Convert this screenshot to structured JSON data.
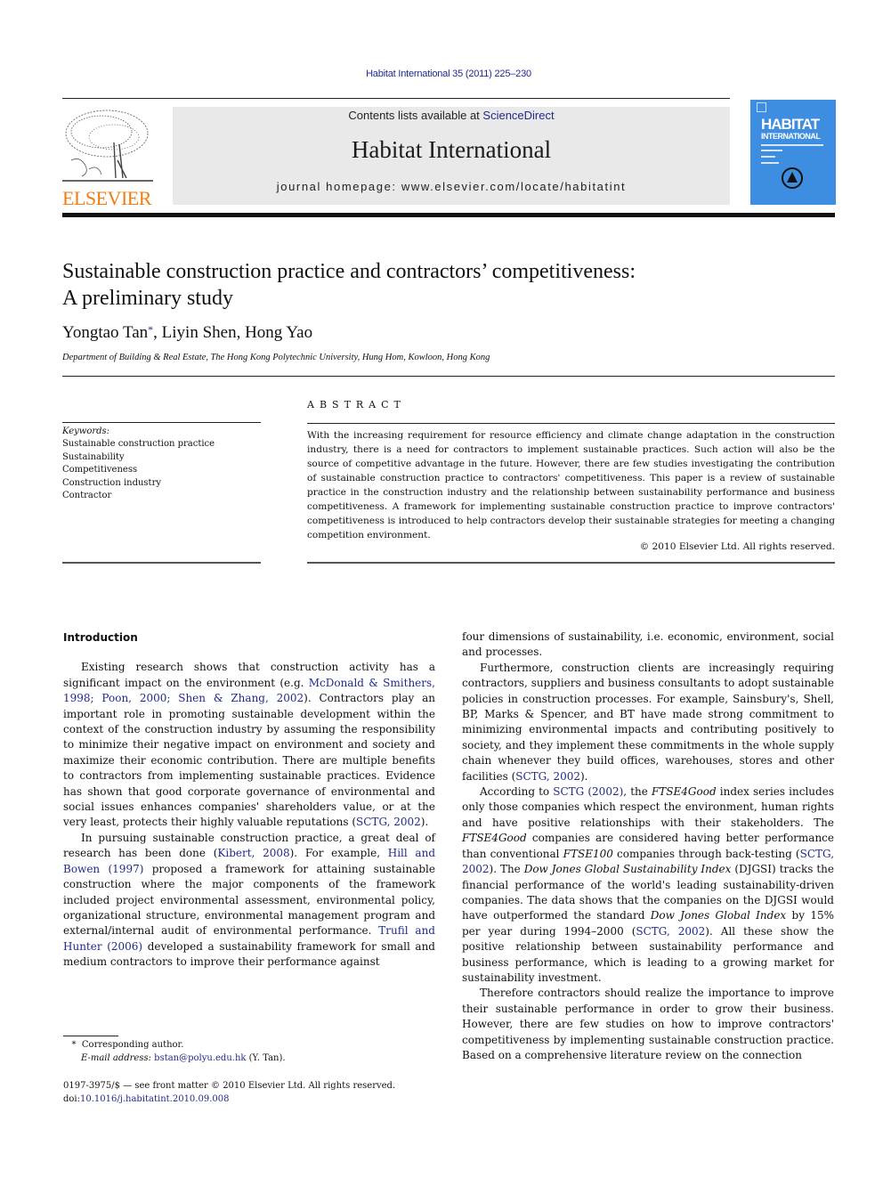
{
  "header": {
    "citation": "Habitat International 35 (2011) 225–230",
    "contents_prefix": "Contents lists available at ",
    "contents_link": "ScienceDirect",
    "journal_name": "Habitat International",
    "homepage": "journal homepage: www.elsevier.com/locate/habitatint",
    "publisher_logo_text": "ELSEVIER",
    "cover_title": "HABITAT",
    "cover_subtitle": "INTERNATIONAL"
  },
  "colors": {
    "link": "#1f2a8a",
    "elsevier_orange": "#f07c12",
    "cover_blue": "#3d8ee0",
    "masthead_gray": "#e9e9e9"
  },
  "article": {
    "title_line1": "Sustainable construction practice and contractors’ competitiveness:",
    "title_line2": "A preliminary study",
    "author1": "Yongtao Tan",
    "author1_mark": "*",
    "authors_rest": ", Liyin Shen, Hong Yao",
    "affiliation": "Department of Building & Real Estate, The Hong Kong Polytechnic University, Hung Hom, Kowloon, Hong Kong"
  },
  "keywords": {
    "label": "Keywords:",
    "items": [
      "Sustainable construction practice",
      "Sustainability",
      "Competitiveness",
      "Construction industry",
      "Contractor"
    ]
  },
  "abstract": {
    "heading": "ABSTRACT",
    "text": "With the increasing requirement for resource efficiency and climate change adaptation in the construction industry, there is a need for contractors to implement sustainable practices. Such action will also be the source of competitive advantage in the future. However, there are few studies investigating the contribution of sustainable construction practice to contractors' competitiveness. This paper is a review of sustainable practice in the construction industry and the relationship between sustainability performance and business competitiveness. A framework for implementing sustainable construction practice to improve contractors' competitiveness is introduced to help contractors develop their sustainable strategies for meeting a changing competition environment.",
    "copyright": "© 2010 Elsevier Ltd. All rights reserved."
  },
  "body": {
    "section_heading": "Introduction",
    "p1": {
      "t1": "Existing research shows that construction activity has a significant impact on the environment (e.g. ",
      "l1": "McDonald & Smithers, 1998; Poon, 2000; Shen & Zhang, 2002",
      "t2": "). Contractors play an important role in promoting sustainable development within the context of the construction industry by assuming the responsibility to minimize their negative impact on environment and society and maximize their economic contribution. There are multiple benefits to contractors from implementing sustainable practices. Evidence has shown that good corporate governance of environmental and social issues enhances companies' shareholders value, or at the very least, protects their highly valuable reputations (",
      "l2": "SCTG, 2002",
      "t3": ")."
    },
    "p2": {
      "t1": "In pursuing sustainable construction practice, a great deal of research has been done (",
      "l1": "Kibert, 2008",
      "t2": "). For example, ",
      "l2": "Hill and Bowen (1997)",
      "t3": " proposed a framework for attaining sustainable construction where the major components of the framework included project environmental assessment, environmental policy, organizational structure, environmental management program and external/internal audit of environmental performance. ",
      "l3": "Trufil and Hunter (2006)",
      "t4": " developed a sustainability framework for small and medium contractors to improve their performance against"
    },
    "p3": {
      "t1": "four dimensions of sustainability, i.e. economic, environment, social and processes."
    },
    "p4": {
      "t1": "Furthermore, construction clients are increasingly requiring contractors, suppliers and business consultants to adopt sustainable policies in construction processes. For example, Sainsbury's, Shell, BP, Marks & Spencer, and BT have made strong commitment to minimizing environmental impacts and contributing positively to society, and they implement these commitments in the whole supply chain whenever they build offices, warehouses, stores and other facilities (",
      "l1": "SCTG, 2002",
      "t2": ")."
    },
    "p5": {
      "t1": "According to ",
      "l1": "SCTG (2002)",
      "t2": ", the ",
      "i1": "FTSE4Good",
      "t3": " index series includes only those companies which respect the environment, human rights and have positive relationships with their stakeholders. The ",
      "i2": "FTSE4Good",
      "t4": " companies are considered having better performance than conventional ",
      "i3": "FTSE100",
      "t5": " companies through back-testing (",
      "l2": "SCTG, 2002",
      "t6": "). The ",
      "i4": "Dow Jones Global Sustainability Index",
      "t7": " (DJGSI) tracks the financial performance of the world's leading sustainability-driven companies. The data shows that the companies on the DJGSI would have outperformed the standard ",
      "i5": "Dow Jones Global Index",
      "t8": " by 15% per year during 1994–2000 (",
      "l3": "SCTG, 2002",
      "t9": "). All these show the positive relationship between sustainability performance and business performance, which is leading to a growing market for sustainability investment."
    },
    "p6": {
      "t1": "Therefore contractors should realize the importance to improve their sustainable performance in order to grow their business. However, there are few studies on how to improve contractors' competitiveness by implementing sustainable construction practice. Based on a comprehensive literature review on the connection"
    }
  },
  "footnote": {
    "mark": "*",
    "corresponding": "Corresponding author.",
    "email_label": "E-mail address:",
    "email": "bstan@polyu.edu.hk",
    "email_suffix": " (Y. Tan)."
  },
  "front_matter": {
    "issn_line": "0197-3975/$ — see front matter © 2010 Elsevier Ltd. All rights reserved.",
    "doi_label": "doi:",
    "doi": "10.1016/j.habitatint.2010.09.008"
  }
}
